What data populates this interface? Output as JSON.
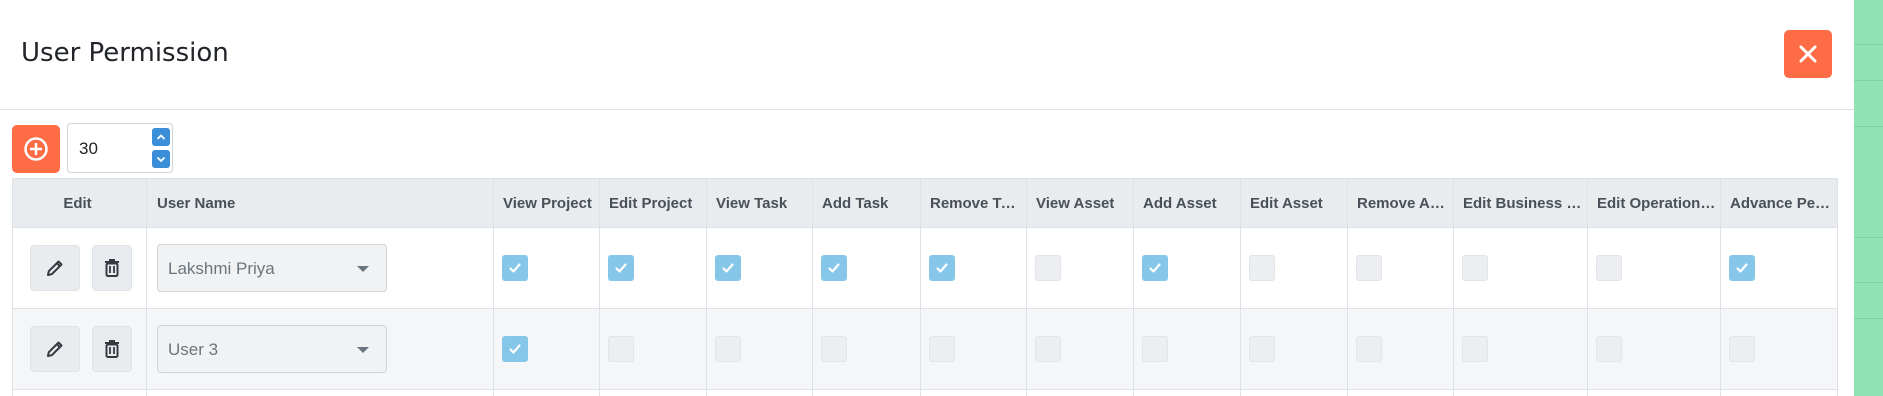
{
  "dialog": {
    "title": "User Permission",
    "close_icon": "close-icon"
  },
  "toolbar": {
    "add_icon": "plus-circle-icon",
    "rows_value": "30"
  },
  "table": {
    "columns": [
      "Edit",
      "User Name",
      "View Project",
      "Edit Project",
      "View Task",
      "Add Task",
      "Remove Task",
      "View Asset",
      "Add Asset",
      "Edit Asset",
      "Remove As…",
      "Edit Business S…",
      "Edit Operation…",
      "Advance Permi…"
    ],
    "rows": [
      {
        "user": "Lakshmi Priya",
        "permissions": [
          true,
          true,
          true,
          true,
          true,
          false,
          true,
          false,
          false,
          false,
          false,
          true
        ]
      },
      {
        "user": "User 3",
        "permissions": [
          true,
          false,
          false,
          false,
          false,
          false,
          false,
          false,
          false,
          false,
          false,
          false
        ]
      }
    ]
  },
  "colors": {
    "accent": "#fd6c44",
    "checkbox_on": "#86c6e8",
    "stepper": "#3a8fd8"
  }
}
